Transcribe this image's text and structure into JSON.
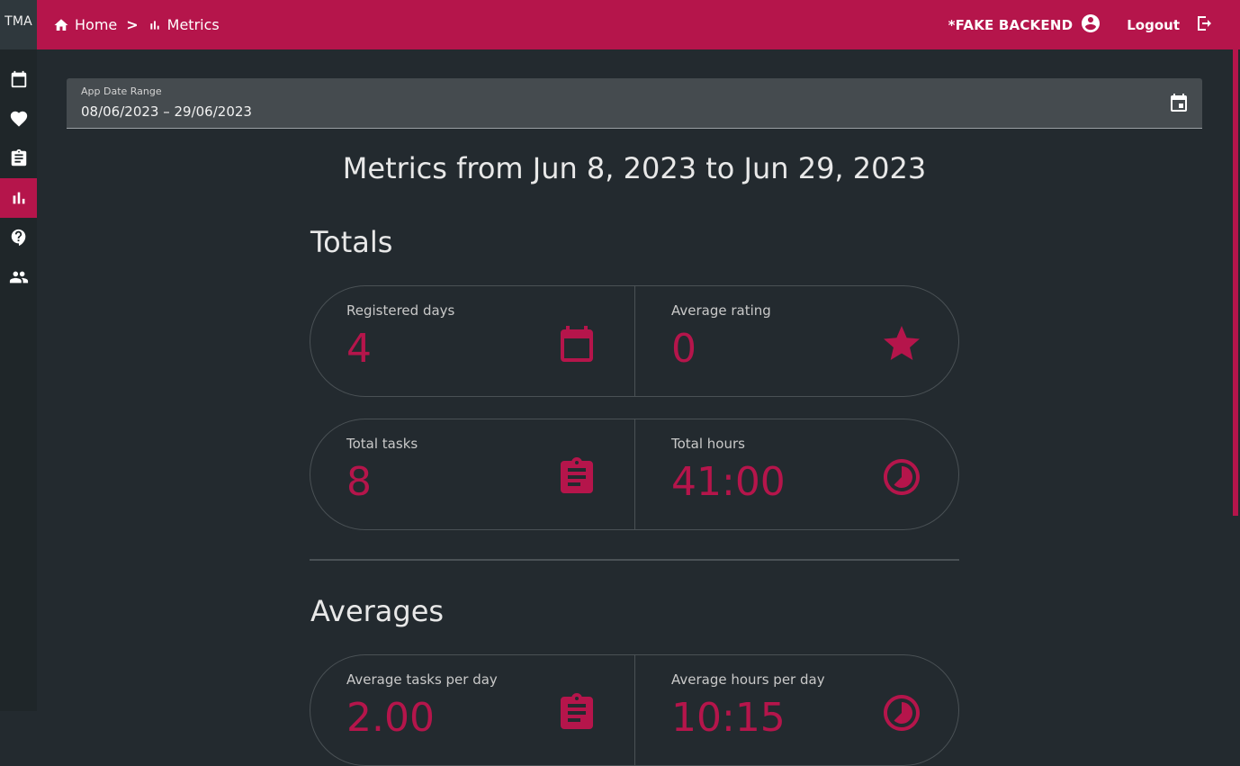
{
  "app": {
    "brand": "TMA"
  },
  "sidebar": {
    "items": [
      {
        "icon": "calendar-icon",
        "active": false
      },
      {
        "icon": "heart-icon",
        "active": false
      },
      {
        "icon": "clipboard-icon",
        "active": false
      },
      {
        "icon": "bar-chart-icon",
        "active": true
      },
      {
        "icon": "help-icon",
        "active": false
      },
      {
        "icon": "people-icon",
        "active": false
      }
    ]
  },
  "header": {
    "breadcrumb": [
      {
        "label": "Home",
        "icon": "home-icon"
      },
      {
        "label": "Metrics",
        "icon": "bar-chart-icon"
      }
    ],
    "separator": ">",
    "backend_label": "*FAKE BACKEND",
    "logout_label": "Logout"
  },
  "date_range": {
    "label": "App Date Range",
    "start": "08/06/2023",
    "end": "29/06/2023",
    "value": "08/06/2023  – 29/06/2023"
  },
  "page": {
    "title": "Metrics from Jun 8, 2023 to Jun 29, 2023"
  },
  "totals": {
    "title": "Totals",
    "registered_days": {
      "label": "Registered days",
      "value": "4",
      "icon": "calendar-icon"
    },
    "average_rating": {
      "label": "Average rating",
      "value": "0",
      "icon": "star-icon"
    },
    "total_tasks": {
      "label": "Total tasks",
      "value": "8",
      "icon": "clipboard-icon"
    },
    "total_hours": {
      "label": "Total hours",
      "value": "41:00",
      "icon": "clock-pie-icon"
    }
  },
  "averages": {
    "title": "Averages",
    "tasks_per_day": {
      "label": "Average tasks per day",
      "value": "2.00",
      "icon": "clipboard-icon"
    },
    "hours_per_day": {
      "label": "Average hours per day",
      "value": "10:15",
      "icon": "clock-pie-icon"
    }
  },
  "colors": {
    "accent": "#b5154b",
    "background": "#232a2f",
    "sidebar": "#1f2629",
    "field": "#454b4f"
  }
}
